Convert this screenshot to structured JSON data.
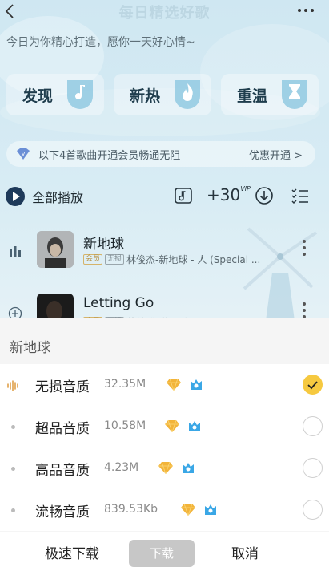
{
  "header": {
    "title": "每日精选好歌",
    "subtitle": "今日为你精心打造，愿你一天好心情~"
  },
  "categories": [
    {
      "label": "发现",
      "icon": "music-note-icon"
    },
    {
      "label": "新热",
      "icon": "flame-icon"
    },
    {
      "label": "重温",
      "icon": "hourglass-icon"
    }
  ],
  "vip_banner": {
    "text": "以下4首歌曲开通会员畅通无阻",
    "action": "优惠开通 >"
  },
  "toolbar": {
    "play_all": "全部播放",
    "plus30": "+30",
    "plus30_sup": "VIP"
  },
  "songs": [
    {
      "title": "新地球",
      "tag1": "会员",
      "tag2": "无损",
      "meta": "林俊杰-新地球 - 人 (Special ..."
    },
    {
      "title": "Letting Go",
      "tag1": "会员",
      "tag2": "无损",
      "meta": "蔡健雅-说到爱"
    }
  ],
  "sheet": {
    "title": "新地球",
    "qualities": [
      {
        "label": "无损音质",
        "size": "32.35M",
        "selected": true
      },
      {
        "label": "超品音质",
        "size": "10.58M",
        "selected": false
      },
      {
        "label": "高品音质",
        "size": "4.23M",
        "selected": false
      },
      {
        "label": "流畅音质",
        "size": "839.53Kb",
        "selected": false
      }
    ],
    "fast_download": "极速下载",
    "download": "下载",
    "cancel": "取消"
  },
  "colors": {
    "accent": "#f6c940",
    "diamond": "#f2b43a",
    "crown": "#3aa7e6",
    "play_icon": "#1e3a5a"
  }
}
